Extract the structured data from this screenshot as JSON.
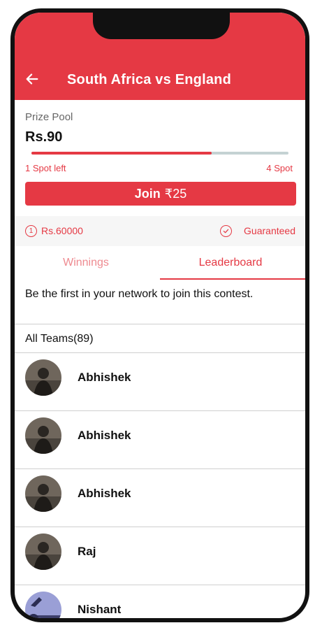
{
  "header": {
    "title": "South Africa vs England",
    "back_icon": "arrow-left-icon",
    "color": "#e53944"
  },
  "prize": {
    "label": "Prize Pool",
    "value": "Rs.90",
    "progress_fraction": 0.7,
    "spots_left": "1 Spot left",
    "spots_total": "4 Spot"
  },
  "join": {
    "label": "Join",
    "amount": "₹25"
  },
  "info": {
    "first_prize": "Rs.60000",
    "first_prize_icon": "numbered-one-circle-icon",
    "guarantee": "Guaranteed",
    "guarantee_icon": "check-circle-icon"
  },
  "tabs": [
    {
      "label": "Winnings",
      "active": false
    },
    {
      "label": "Leaderboard",
      "active": true
    }
  ],
  "note": "Be the first in your network to join this contest.",
  "all_teams_label": "All Teams(89)",
  "teams": [
    {
      "name": "Abhishek",
      "avatar": "photo-man-avatar"
    },
    {
      "name": "Abhishek",
      "avatar": "photo-man-avatar"
    },
    {
      "name": "Abhishek",
      "avatar": "photo-man-avatar"
    },
    {
      "name": "Raj",
      "avatar": "photo-man-avatar"
    },
    {
      "name": "Nishant",
      "avatar": "photo-sky-avatar"
    }
  ]
}
